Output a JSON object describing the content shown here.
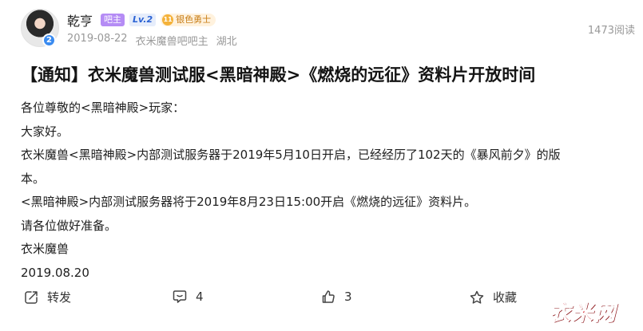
{
  "author": {
    "name": "乾亨",
    "owner_badge": "吧主",
    "level_badge": "Lv.2",
    "level_title_number": "11",
    "level_title": "银色勇士",
    "date": "2019-08-22",
    "role": "衣米魔兽吧吧主",
    "location": "湖北",
    "avatar_level": "2"
  },
  "views": "1473阅读",
  "post": {
    "title": "【通知】衣米魔兽测试服<黑暗神殿>《燃烧的远征》资料片开放时间",
    "lines": [
      "各位尊敬的<黑暗神殿>玩家：",
      "大家好。",
      "衣米魔兽<黑暗神殿>内部测试服务器于2019年5月10日开启，已经经历了102天的《暴风前夕》的版",
      "本。",
      "<黑暗神殿>内部测试服务器将于2019年8月23日15:00开启《燃烧的远征》资料片。",
      "请各位做好准备。",
      "衣米魔兽",
      "2019.08.20"
    ]
  },
  "actions": {
    "share_label": "转发",
    "comment_count": "4",
    "like_count": "3",
    "collect_label": "收藏"
  },
  "watermark": "衣米网",
  "colors": {
    "owner_badge": "#b58cf5",
    "level_badge_text": "#2a62d4",
    "title_badge_text": "#c87d16",
    "watermark": "#d4202a"
  }
}
